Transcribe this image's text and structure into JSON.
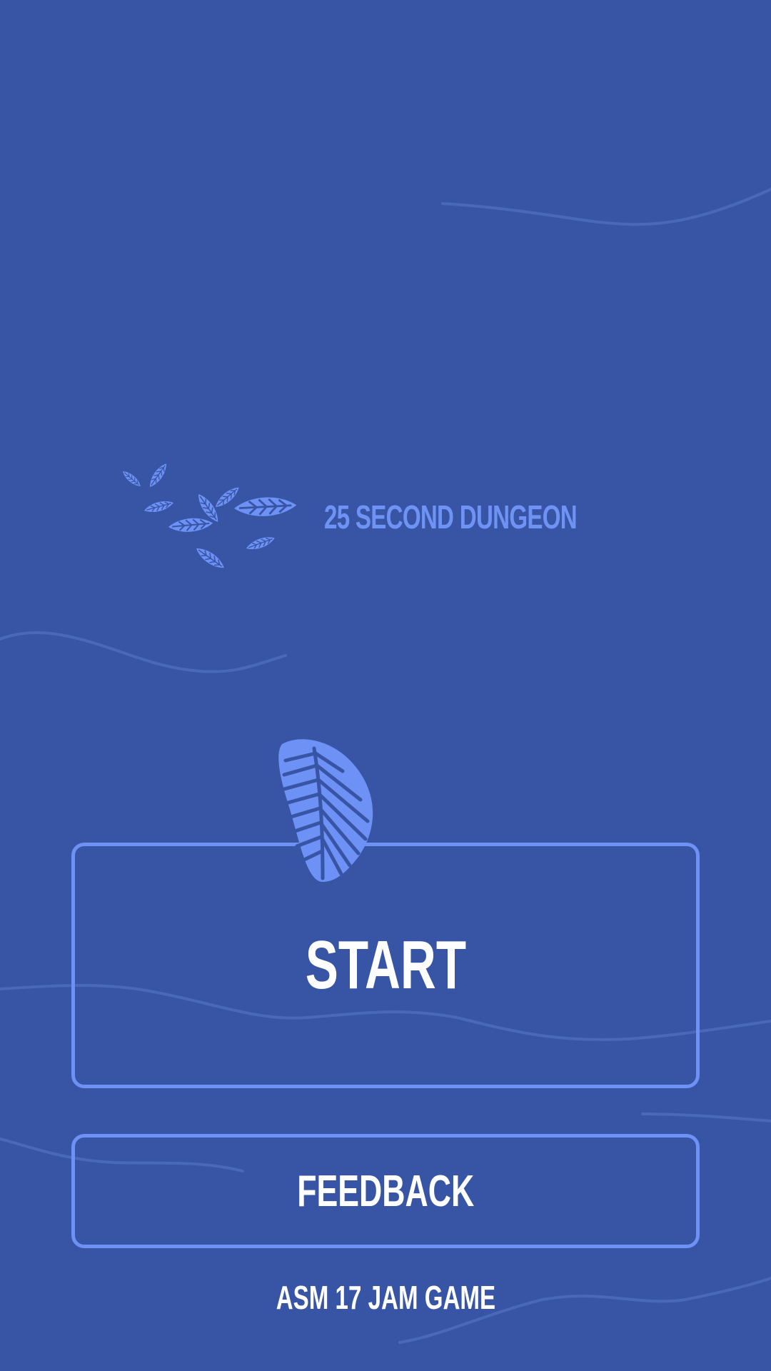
{
  "game": {
    "title": "25 SECOND DUNGEON",
    "footer": "ASM 17 JAM GAME"
  },
  "menu": {
    "start_label": "START",
    "feedback_label": "FEEDBACK"
  },
  "icons": {
    "logo": "leaves-cluster-icon",
    "start_decoration": "leaf-icon"
  },
  "colors": {
    "background": "#3755a4",
    "accent": "#6d91f5",
    "text": "#ffffff",
    "title": "#6f93f4"
  }
}
